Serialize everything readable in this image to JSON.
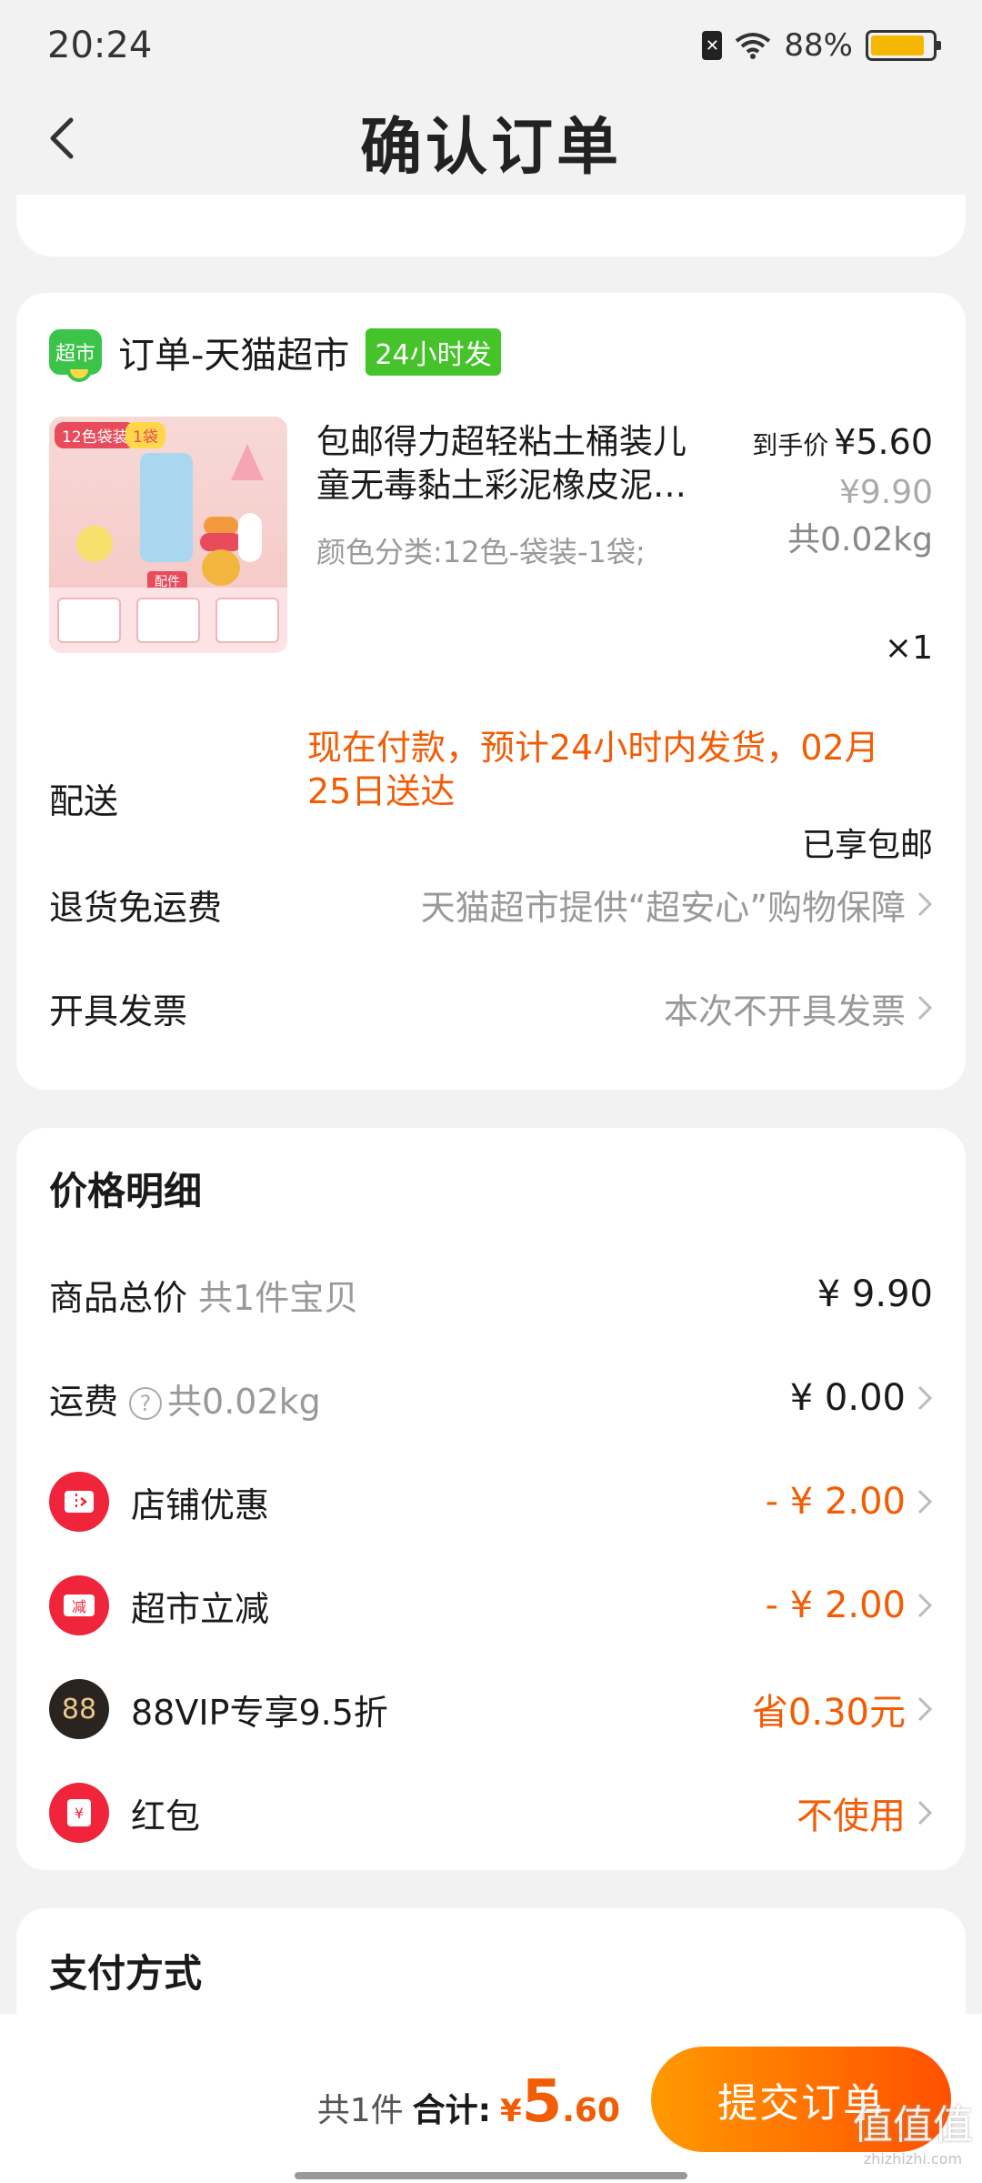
{
  "status_bar": {
    "time": "20:24",
    "battery": "88%",
    "battery_level": 0.88
  },
  "header": {
    "title": "确认订单"
  },
  "order": {
    "shop_logo_text": "超市",
    "shop_name": "订单-天猫超市",
    "ship_badge": "24小时发",
    "product": {
      "image_tag": "12色袋装",
      "image_tag2": "1袋",
      "image_label": "配件",
      "title_line1": "包邮得力超轻粘土桶装儿",
      "title_line2": "童无毒黏土彩泥橡皮泥…",
      "spec": "颜色分类:12色-袋装-1袋;",
      "final_price_label": "到手价",
      "final_price": "¥5.60",
      "original_price": "¥9.90",
      "weight": "共0.02kg",
      "quantity": "×1"
    },
    "delivery": {
      "label": "配送",
      "text_line1": "现在付款，预计24小时内发货，02月",
      "text_line2": "25日送达",
      "shipping_note": "已享包邮"
    },
    "return_shipping": {
      "label": "退货免运费",
      "value": "天猫超市提供“超安心”购物保障"
    },
    "invoice": {
      "label": "开具发票",
      "value": "本次不开具发票"
    }
  },
  "price_detail": {
    "title": "价格明细",
    "goods_total": {
      "label": "商品总价",
      "sub": "共1件宝贝",
      "amount": "¥ 9.90"
    },
    "freight": {
      "label": "运费",
      "help": "?",
      "sub": "共0.02kg",
      "amount": "¥ 0.00"
    },
    "shop_discount": {
      "label": "店铺优惠",
      "amount": "- ¥ 2.00"
    },
    "market_discount": {
      "label": "超市立减",
      "icon_text": "减",
      "amount": "- ¥ 2.00"
    },
    "vip": {
      "label": "88VIP专享9.5折",
      "icon_text": "88",
      "amount": "省0.30元"
    },
    "red_packet": {
      "label": "红包",
      "icon_text": "¥",
      "amount": "不使用"
    }
  },
  "payment": {
    "title": "支付方式"
  },
  "bottom": {
    "count": "共1件",
    "total_label": "合计:",
    "currency": "¥",
    "total_int": "5",
    "total_dec": ".60",
    "submit": "提交订单"
  },
  "watermark": {
    "text": "值值值",
    "domain": "zhizhizhi.com"
  },
  "colors": {
    "accent": "#ff5000",
    "price_red": "#f25c05",
    "badge_green": "#46c32b"
  }
}
